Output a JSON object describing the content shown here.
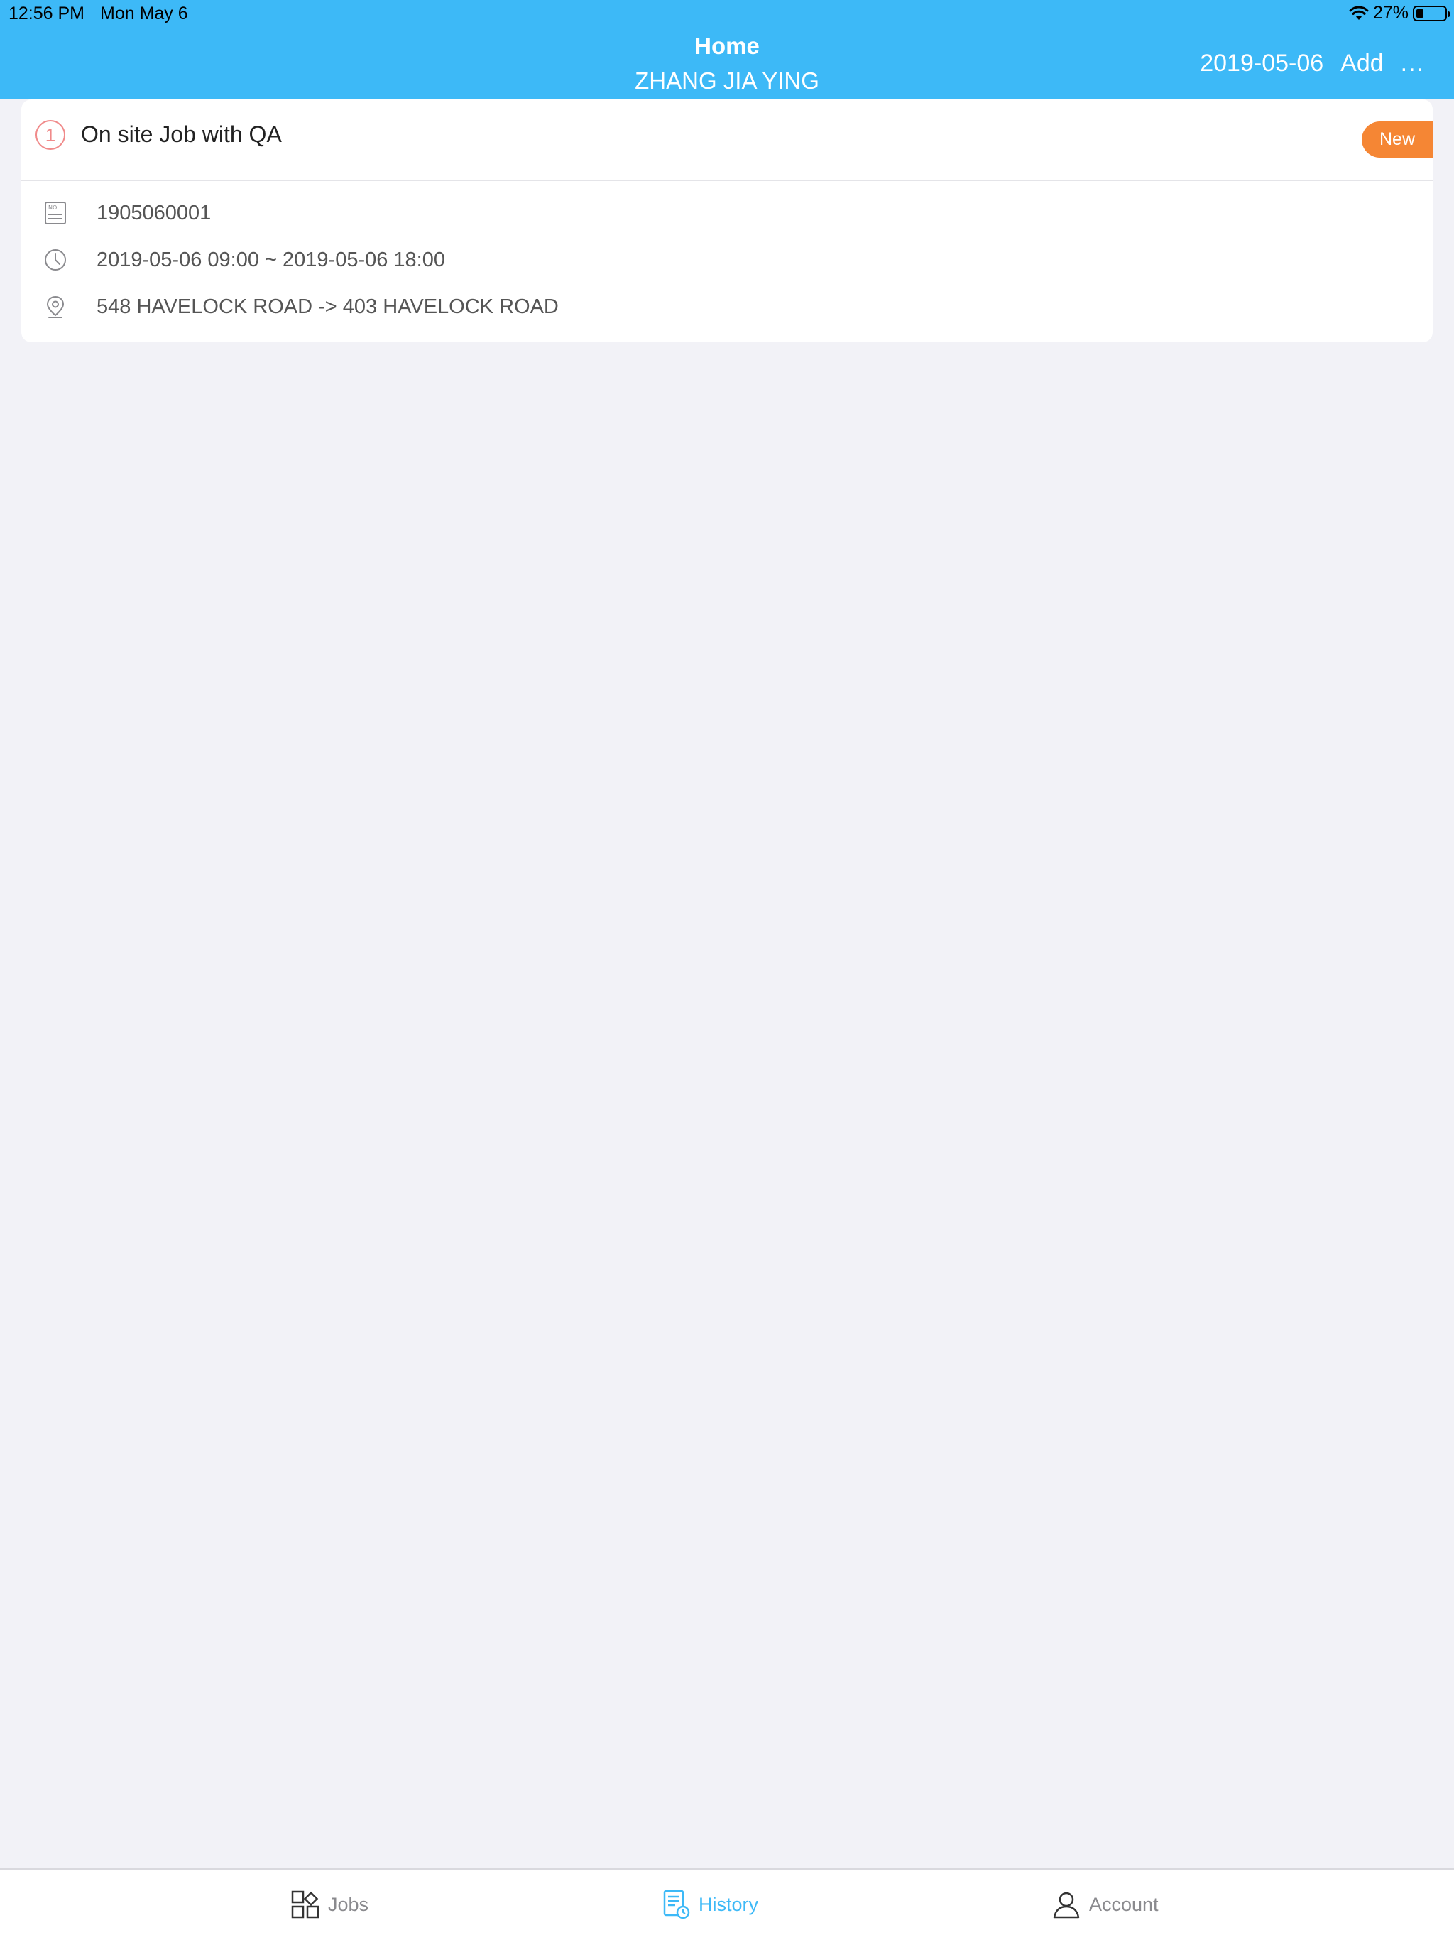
{
  "status_bar": {
    "time": "12:56 PM",
    "date": "Mon May 6",
    "battery": "27%",
    "battery_level": 0.27
  },
  "header": {
    "title": "Home",
    "subtitle": "ZHANG JIA YING",
    "date": "2019-05-06",
    "add_label": "Add",
    "more_label": "..."
  },
  "job": {
    "index": "1",
    "title": "On site Job with QA",
    "status": "New",
    "number": "1905060001",
    "time_range": "2019-05-06 09:00 ~ 2019-05-06 18:00",
    "route": "548 HAVELOCK ROAD -> 403 HAVELOCK ROAD"
  },
  "tabs": {
    "jobs": "Jobs",
    "history": "History",
    "account": "Account"
  },
  "colors": {
    "header": "#3db9f7",
    "badge": "#f58634",
    "index": "#f08a8a",
    "active_tab": "#3db9f7"
  }
}
